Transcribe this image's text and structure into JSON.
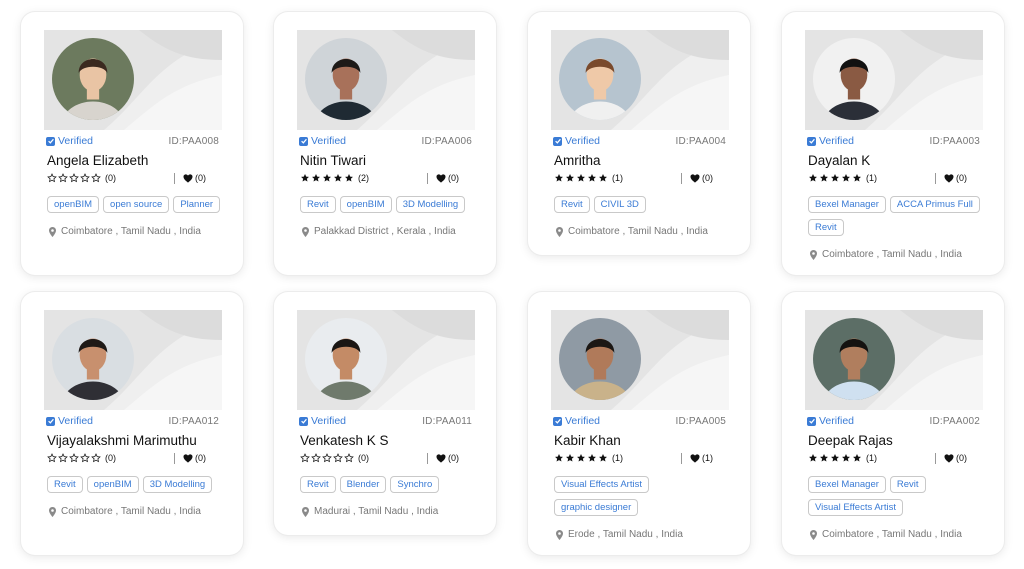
{
  "colors": {
    "accent": "#3a7bd5",
    "muted": "#777777",
    "banner": "#e4e4e4"
  },
  "icons": {
    "verified": "check-icon",
    "rating": "star-icon",
    "likes": "heart-icon",
    "location": "pin-icon"
  },
  "profiles": [
    {
      "verified": "Verified",
      "id": "ID:PAA008",
      "name": "Angela Elizabeth",
      "rating": 0,
      "rating_count": "(0)",
      "likes": "(0)",
      "tags": [
        "openBIM",
        "open source",
        "Planner"
      ],
      "location": "Coimbatore , Tamil Nadu , India"
    },
    {
      "verified": "Verified",
      "id": "ID:PAA006",
      "name": "Nitin Tiwari",
      "rating": 5,
      "rating_count": "(2)",
      "likes": "(0)",
      "tags": [
        "Revit",
        "openBIM",
        "3D Modelling"
      ],
      "location": "Palakkad District , Kerala , India"
    },
    {
      "verified": "Verified",
      "id": "ID:PAA004",
      "name": "Amritha",
      "rating": 5,
      "rating_count": "(1)",
      "likes": "(0)",
      "tags": [
        "Revit",
        "CIVIL 3D"
      ],
      "location": "Coimbatore , Tamil Nadu , India"
    },
    {
      "verified": "Verified",
      "id": "ID:PAA003",
      "name": "Dayalan K",
      "rating": 5,
      "rating_count": "(1)",
      "likes": "(0)",
      "tags": [
        "Bexel Manager",
        "ACCA Primus Full",
        "Revit"
      ],
      "location": "Coimbatore , Tamil Nadu , India"
    },
    {
      "verified": "Verified",
      "id": "ID:PAA012",
      "name": "Vijayalakshmi Marimuthu",
      "rating": 0,
      "rating_count": "(0)",
      "likes": "(0)",
      "tags": [
        "Revit",
        "openBIM",
        "3D Modelling"
      ],
      "location": "Coimbatore , Tamil Nadu , India"
    },
    {
      "verified": "Verified",
      "id": "ID:PAA011",
      "name": "Venkatesh K S",
      "rating": 0,
      "rating_count": "(0)",
      "likes": "(0)",
      "tags": [
        "Revit",
        "Blender",
        "Synchro"
      ],
      "location": "Madurai , Tamil Nadu , India"
    },
    {
      "verified": "Verified",
      "id": "ID:PAA005",
      "name": "Kabir Khan",
      "rating": 5,
      "rating_count": "(1)",
      "likes": "(1)",
      "tags": [
        "Visual Effects Artist",
        "graphic designer"
      ],
      "location": "Erode , Tamil Nadu , India"
    },
    {
      "verified": "Verified",
      "id": "ID:PAA002",
      "name": "Deepak Rajas",
      "rating": 5,
      "rating_count": "(1)",
      "likes": "(0)",
      "tags": [
        "Bexel Manager",
        "Revit",
        "Visual Effects Artist"
      ],
      "location": "Coimbatore , Tamil Nadu , India"
    }
  ]
}
